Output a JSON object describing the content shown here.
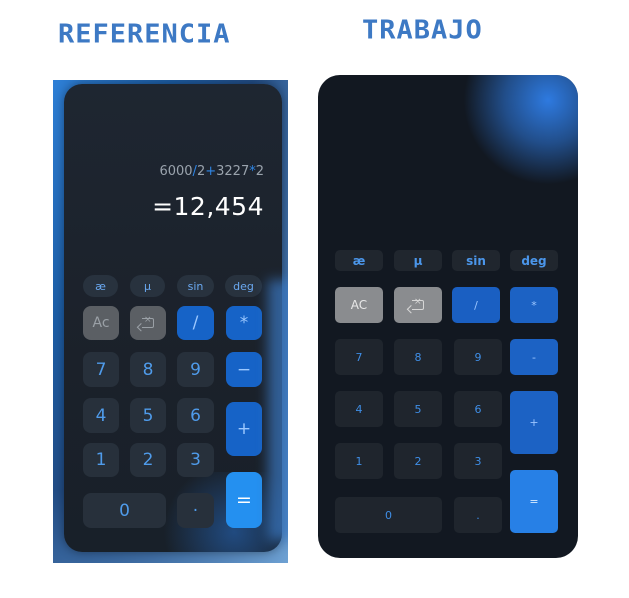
{
  "titles": {
    "reference": "REFERENCIA",
    "work": "TRABAJO"
  },
  "colors": {
    "accent": "#2f86e6",
    "title": "#3d79c4",
    "calc_bg": "#121821"
  },
  "reference": {
    "expression": {
      "a": "6000",
      "op1": "/",
      "b": "2",
      "op2": "+",
      "c": "3227",
      "op3": "*",
      "d": "2"
    },
    "result": "=12,454",
    "fn_keys": [
      "æ",
      "μ",
      "sin",
      "deg"
    ],
    "keys": {
      "ac": "Ac",
      "backspace": "backspace-icon",
      "divide": "/",
      "multiply": "*",
      "n7": "7",
      "n8": "8",
      "n9": "9",
      "minus": "−",
      "n4": "4",
      "n5": "5",
      "n6": "6",
      "plus": "+",
      "n1": "1",
      "n2": "2",
      "n3": "3",
      "n0": "0",
      "dot": "·",
      "equals": "="
    }
  },
  "work": {
    "fn_keys": [
      "æ",
      "μ",
      "sin",
      "deg"
    ],
    "keys": {
      "ac": "AC",
      "backspace": "backspace-icon",
      "divide": "/",
      "multiply": "*",
      "n7": "7",
      "n8": "8",
      "n9": "9",
      "minus": "-",
      "n4": "4",
      "n5": "5",
      "n6": "6",
      "plus": "+",
      "n1": "1",
      "n2": "2",
      "n3": "3",
      "n0": "0",
      "dot": ".",
      "equals": "="
    }
  }
}
